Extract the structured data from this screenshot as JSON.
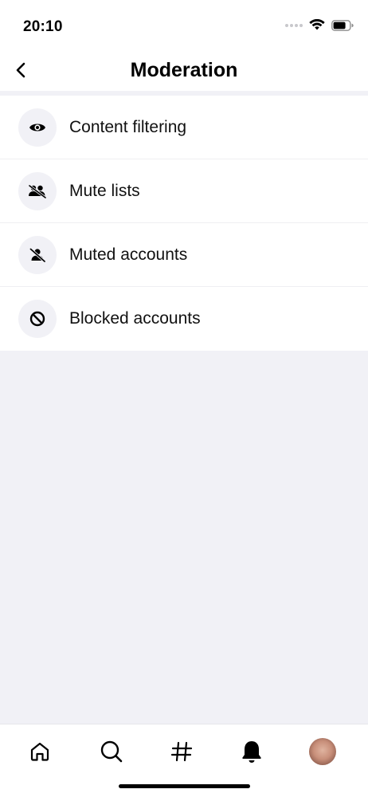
{
  "status_bar": {
    "time": "20:10"
  },
  "header": {
    "title": "Moderation"
  },
  "menu": {
    "items": [
      {
        "label": "Content filtering",
        "icon": "eye-icon"
      },
      {
        "label": "Mute lists",
        "icon": "users-slash-icon"
      },
      {
        "label": "Muted accounts",
        "icon": "user-slash-icon"
      },
      {
        "label": "Blocked accounts",
        "icon": "ban-icon"
      }
    ]
  },
  "tab_bar": {
    "tabs": [
      {
        "name": "Home",
        "icon": "home-icon"
      },
      {
        "name": "Search",
        "icon": "search-icon"
      },
      {
        "name": "Feeds",
        "icon": "hashtag-icon"
      },
      {
        "name": "Notifications",
        "icon": "bell-icon"
      },
      {
        "name": "Profile",
        "icon": "avatar"
      }
    ]
  },
  "colors": {
    "background": "#f1f1f6",
    "surface": "#ffffff",
    "text": "#000000",
    "icon_bg": "#f1f1f6"
  }
}
